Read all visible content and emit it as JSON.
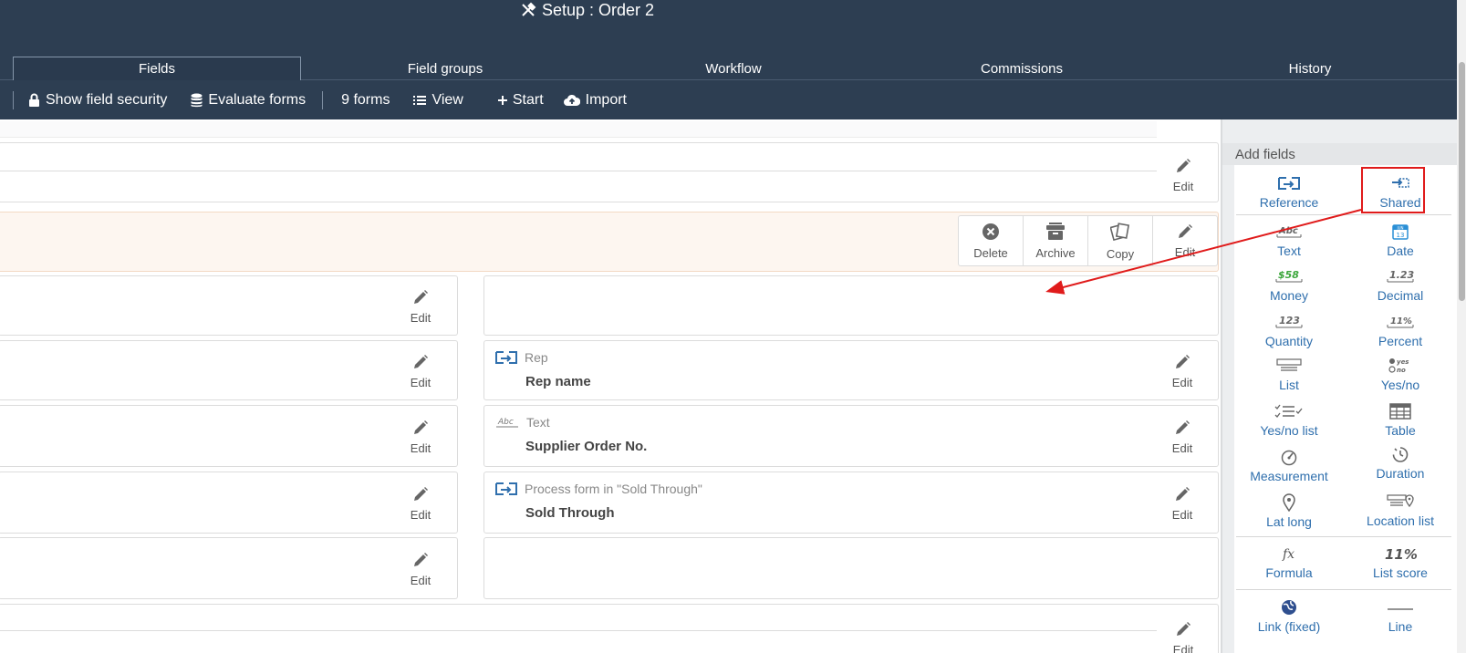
{
  "header": {
    "title": "Setup : Order 2",
    "tabs": [
      {
        "label": "Fields",
        "active": true
      },
      {
        "label": "Field groups",
        "active": false
      },
      {
        "label": "Workflow",
        "active": false
      },
      {
        "label": "Commissions",
        "active": false
      },
      {
        "label": "History",
        "active": false
      }
    ],
    "toolbar": {
      "show_field_security": "Show field security",
      "evaluate_forms": "Evaluate forms",
      "forms_count": "9 forms",
      "view": "View",
      "start": "Start",
      "import": "Import"
    }
  },
  "main": {
    "edit_label": "Edit",
    "actions": {
      "delete": "Delete",
      "archive": "Archive",
      "copy": "Copy",
      "edit": "Edit"
    },
    "fields": [
      {
        "type": "Rep",
        "name": "Rep name",
        "icon": "reference-icon"
      },
      {
        "type": "Text",
        "name": "Supplier Order No.",
        "icon": "text-abc-icon"
      },
      {
        "type": "Process form in \"Sold Through\"",
        "name": "Sold Through",
        "icon": "reference-icon"
      }
    ]
  },
  "sidebar": {
    "title": "Add fields",
    "items": {
      "reference": "Reference",
      "shared": "Shared",
      "text": "Text",
      "date": "Date",
      "money": "Money",
      "decimal": "Decimal",
      "quantity": "Quantity",
      "percent": "Percent",
      "list": "List",
      "yes_no": "Yes/no",
      "yes_no_list": "Yes/no list",
      "table": "Table",
      "measurement": "Measurement",
      "duration": "Duration",
      "lat_long": "Lat long",
      "location_list": "Location list",
      "formula": "Formula",
      "list_score": "List score",
      "link_fixed": "Link (fixed)",
      "line": "Line"
    },
    "icon_glyphs": {
      "text": "Abc",
      "money": "$58",
      "decimal": "1.23",
      "quantity": "123",
      "percent": "11%",
      "yes": "yes",
      "no": "no",
      "date_month": "JUN",
      "date_day": "13",
      "formula": "fx",
      "list_score": "11%"
    }
  },
  "colors": {
    "header_bg": "#2d3e52",
    "link_blue": "#2f6fad",
    "highlight_red": "#e01b1b",
    "orange_panel": "#fdf6f0"
  }
}
